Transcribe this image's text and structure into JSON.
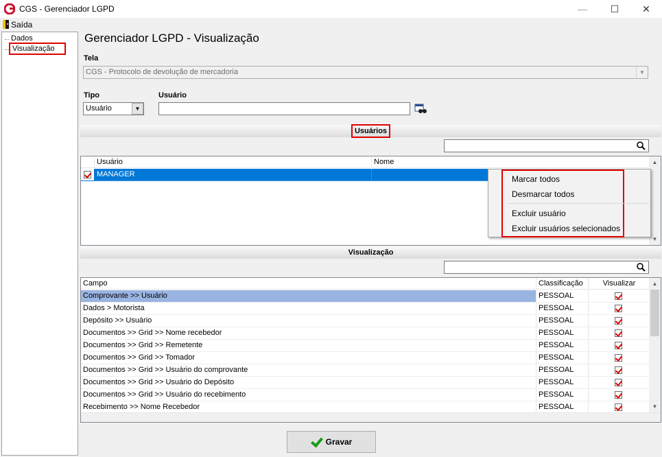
{
  "window": {
    "title": "CGS - Gerenciador LGPD",
    "minimize": "—",
    "maximize": "☐",
    "close": "✕"
  },
  "menu": {
    "exit": "Saída"
  },
  "sidebar": {
    "items": [
      {
        "label": "Dados"
      },
      {
        "label": "Visualização"
      }
    ]
  },
  "page": {
    "title": "Gerenciador LGPD - Visualização"
  },
  "form": {
    "tela_label": "Tela",
    "tela_value": "CGS - Protocolo de devolução de mercadoria",
    "tipo_label": "Tipo",
    "tipo_value": "Usuário",
    "usuario_label": "Usuário",
    "usuario_value": ""
  },
  "users_section": {
    "title": "Usuários",
    "columns": [
      "Usuário",
      "Nome"
    ],
    "rows": [
      {
        "usuario": "MANAGER",
        "nome": "",
        "checked": true
      }
    ]
  },
  "context_menu": {
    "items": [
      "Marcar todos",
      "Desmarcar todos",
      "Excluir usuário",
      "Excluir usuários selecionados"
    ]
  },
  "view_section": {
    "title": "Visualização",
    "columns": [
      "Campo",
      "Classificação",
      "Visualizar"
    ],
    "rows": [
      {
        "campo": "Comprovante >> Usuário",
        "classificacao": "PESSOAL",
        "visualizar": true
      },
      {
        "campo": "Dados > Motorista",
        "classificacao": "PESSOAL",
        "visualizar": true
      },
      {
        "campo": "Depósito >> Usuário",
        "classificacao": "PESSOAL",
        "visualizar": true
      },
      {
        "campo": "Documentos >> Grid >> Nome recebedor",
        "classificacao": "PESSOAL",
        "visualizar": true
      },
      {
        "campo": "Documentos >> Grid >> Remetente",
        "classificacao": "PESSOAL",
        "visualizar": true
      },
      {
        "campo": "Documentos >> Grid >> Tomador",
        "classificacao": "PESSOAL",
        "visualizar": true
      },
      {
        "campo": "Documentos >> Grid >> Usuário do comprovante",
        "classificacao": "PESSOAL",
        "visualizar": true
      },
      {
        "campo": "Documentos >> Grid >> Usuário do Depósito",
        "classificacao": "PESSOAL",
        "visualizar": true
      },
      {
        "campo": "Documentos >> Grid >> Usuário do recebimento",
        "classificacao": "PESSOAL",
        "visualizar": true
      },
      {
        "campo": "Recebimento >> Nome Recebedor",
        "classificacao": "PESSOAL",
        "visualizar": true
      }
    ]
  },
  "buttons": {
    "save": "Gravar"
  },
  "colors": {
    "selection": "#0078d7",
    "row_highlight": "#99b4e1",
    "annotation": "#e00000"
  }
}
